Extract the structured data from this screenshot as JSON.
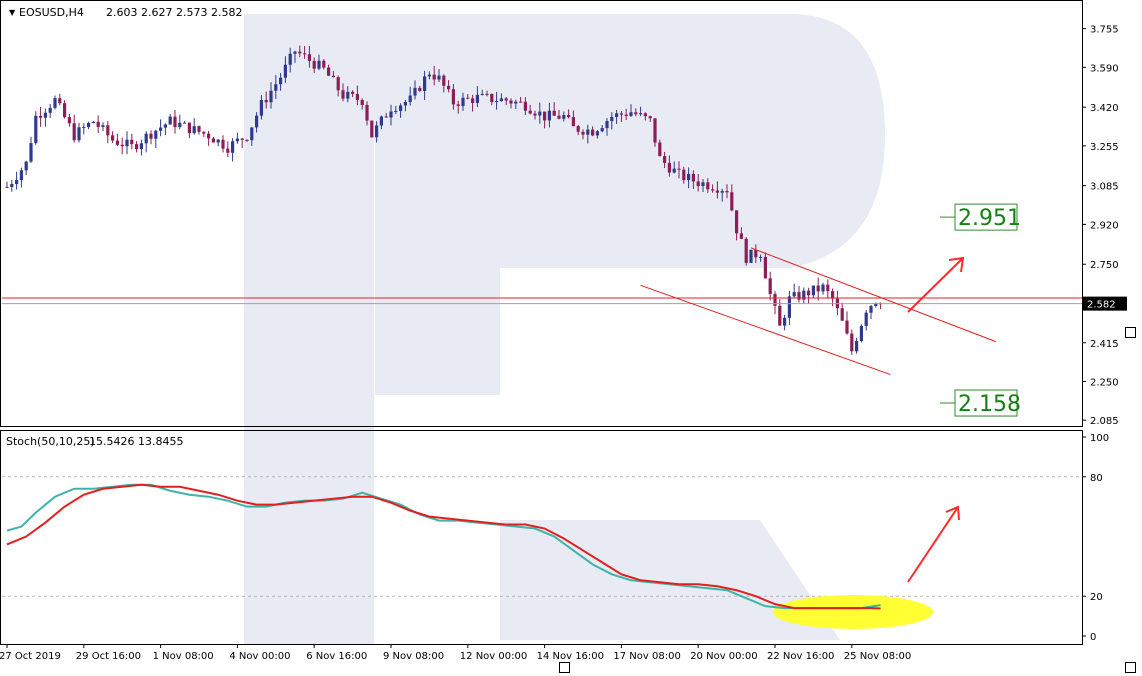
{
  "chart_header": {
    "symbol_label": "EOSUSD,H4",
    "ohlc_text": "2.603 2.627 2.573 2.582"
  },
  "indicator_header": {
    "label": "Stoch(50,10,25)",
    "values_text": "15.5426 13.8455"
  },
  "colors": {
    "bull_candle": "#2f3a8c",
    "bear_candle": "#8b1e56",
    "price_line": "#e02020",
    "stoch_main": "#3fb3a8",
    "stoch_signal": "#e02020",
    "annotation_arrow": "#ff2a2a",
    "target_box_border": "#2e8b2e",
    "target_text": "#168016",
    "highlight_ellipse": "#ffff33",
    "watermark": "#e8ebf4"
  },
  "chart_data": [
    {
      "type": "candlestick",
      "title": "EOSUSD,H4",
      "price_axis_ticks": [
        "3.755",
        "3.590",
        "3.420",
        "3.255",
        "3.085",
        "2.920",
        "2.750",
        "2.580",
        "2.415",
        "2.250",
        "2.085"
      ],
      "price_axis_tick_values": [
        3.755,
        3.59,
        3.42,
        3.255,
        3.085,
        2.92,
        2.75,
        2.58,
        2.415,
        2.25,
        2.085
      ],
      "ylim": [
        2.06,
        3.86
      ],
      "current_price_label": "2.582",
      "current_price": 2.582,
      "red_level": 2.606,
      "x_axis_labels": [
        "27 Oct 2019",
        "29 Oct 16:00",
        "1 Nov 08:00",
        "4 Nov 00:00",
        "6 Nov 16:00",
        "9 Nov 08:00",
        "12 Nov 00:00",
        "14 Nov 16:00",
        "17 Nov 08:00",
        "20 Nov 00:00",
        "22 Nov 16:00",
        "25 Nov 08:00"
      ],
      "x_axis_label_bar_index": [
        0,
        16,
        32,
        48,
        64,
        80,
        96,
        112,
        128,
        144,
        160,
        176
      ],
      "candle_count": 183,
      "close_path": [
        [
          0,
          3.08
        ],
        [
          4,
          3.18
        ],
        [
          6,
          3.38
        ],
        [
          10,
          3.45
        ],
        [
          14,
          3.3
        ],
        [
          18,
          3.36
        ],
        [
          22,
          3.28
        ],
        [
          26,
          3.25
        ],
        [
          30,
          3.31
        ],
        [
          34,
          3.36
        ],
        [
          38,
          3.33
        ],
        [
          42,
          3.3
        ],
        [
          46,
          3.25
        ],
        [
          50,
          3.3
        ],
        [
          53,
          3.43
        ],
        [
          57,
          3.55
        ],
        [
          60,
          3.66
        ],
        [
          63,
          3.62
        ],
        [
          66,
          3.58
        ],
        [
          70,
          3.47
        ],
        [
          74,
          3.45
        ],
        [
          76,
          3.3
        ],
        [
          80,
          3.42
        ],
        [
          84,
          3.45
        ],
        [
          88,
          3.57
        ],
        [
          90,
          3.54
        ],
        [
          93,
          3.44
        ],
        [
          98,
          3.46
        ],
        [
          104,
          3.45
        ],
        [
          108,
          3.43
        ],
        [
          112,
          3.38
        ],
        [
          116,
          3.38
        ],
        [
          118,
          3.33
        ],
        [
          122,
          3.32
        ],
        [
          126,
          3.38
        ],
        [
          130,
          3.4
        ],
        [
          134,
          3.36
        ],
        [
          136,
          3.2
        ],
        [
          140,
          3.13
        ],
        [
          144,
          3.1
        ],
        [
          150,
          3.07
        ],
        [
          152,
          2.9
        ],
        [
          154,
          2.78
        ],
        [
          157,
          2.8
        ],
        [
          159,
          2.62
        ],
        [
          161,
          2.48
        ],
        [
          163,
          2.6
        ],
        [
          167,
          2.63
        ],
        [
          170,
          2.65
        ],
        [
          172,
          2.6
        ],
        [
          174,
          2.5
        ],
        [
          176,
          2.38
        ],
        [
          177,
          2.44
        ],
        [
          179,
          2.56
        ],
        [
          181,
          2.6
        ],
        [
          182,
          2.582
        ]
      ],
      "channel_upper": [
        [
          155,
          2.82
        ],
        [
          206,
          2.42
        ]
      ],
      "channel_lower": [
        [
          132,
          2.66
        ],
        [
          184,
          2.28
        ]
      ],
      "target_up_label": "2.951",
      "target_up_value": 2.951,
      "target_down_label": "2.158",
      "target_down_value": 2.158
    },
    {
      "type": "line",
      "title": "Stoch(50,10,25)",
      "y_axis_ticks": [
        "100",
        "80",
        "20",
        "0"
      ],
      "y_axis_tick_values": [
        100,
        80,
        20,
        0
      ],
      "levels": [
        80,
        20
      ],
      "ylim": [
        0,
        100
      ],
      "series": [
        {
          "name": "main",
          "value_label": "15.5426",
          "points": [
            [
              0,
              53
            ],
            [
              3,
              55
            ],
            [
              6,
              62
            ],
            [
              10,
              70
            ],
            [
              14,
              74
            ],
            [
              18,
              74
            ],
            [
              22,
              75
            ],
            [
              26,
              76
            ],
            [
              30,
              76
            ],
            [
              34,
              73
            ],
            [
              38,
              71
            ],
            [
              42,
              70
            ],
            [
              46,
              68
            ],
            [
              50,
              65
            ],
            [
              54,
              65
            ],
            [
              58,
              67
            ],
            [
              62,
              68
            ],
            [
              66,
              68
            ],
            [
              70,
              69
            ],
            [
              74,
              72
            ],
            [
              78,
              69
            ],
            [
              82,
              66
            ],
            [
              86,
              61
            ],
            [
              90,
              58
            ],
            [
              94,
              58
            ],
            [
              98,
              57
            ],
            [
              102,
              56
            ],
            [
              106,
              55
            ],
            [
              110,
              54
            ],
            [
              114,
              50
            ],
            [
              118,
              43
            ],
            [
              122,
              36
            ],
            [
              126,
              31
            ],
            [
              130,
              28
            ],
            [
              134,
              27
            ],
            [
              138,
              26
            ],
            [
              142,
              25
            ],
            [
              146,
              24
            ],
            [
              150,
              23
            ],
            [
              154,
              19
            ],
            [
              158,
              15
            ],
            [
              162,
              14
            ],
            [
              166,
              14
            ],
            [
              170,
              14
            ],
            [
              174,
              14
            ],
            [
              178,
              14
            ],
            [
              182,
              15.5
            ]
          ]
        },
        {
          "name": "signal",
          "value_label": "13.8455",
          "points": [
            [
              0,
              46
            ],
            [
              4,
              50
            ],
            [
              8,
              57
            ],
            [
              12,
              65
            ],
            [
              16,
              71
            ],
            [
              20,
              74
            ],
            [
              24,
              75
            ],
            [
              28,
              76
            ],
            [
              32,
              75
            ],
            [
              36,
              75
            ],
            [
              40,
              73
            ],
            [
              44,
              71
            ],
            [
              48,
              68
            ],
            [
              52,
              66
            ],
            [
              56,
              66
            ],
            [
              60,
              67
            ],
            [
              64,
              68
            ],
            [
              68,
              69
            ],
            [
              72,
              70
            ],
            [
              76,
              70
            ],
            [
              80,
              67
            ],
            [
              84,
              63
            ],
            [
              88,
              60
            ],
            [
              92,
              59
            ],
            [
              96,
              58
            ],
            [
              100,
              57
            ],
            [
              104,
              56
            ],
            [
              108,
              56
            ],
            [
              112,
              54
            ],
            [
              116,
              49
            ],
            [
              120,
              43
            ],
            [
              124,
              37
            ],
            [
              128,
              31
            ],
            [
              132,
              28
            ],
            [
              136,
              27
            ],
            [
              140,
              26
            ],
            [
              144,
              26
            ],
            [
              148,
              25
            ],
            [
              152,
              23
            ],
            [
              156,
              20
            ],
            [
              160,
              16
            ],
            [
              164,
              14
            ],
            [
              168,
              14
            ],
            [
              172,
              14
            ],
            [
              176,
              14
            ],
            [
              180,
              14
            ],
            [
              182,
              13.8
            ]
          ]
        }
      ]
    }
  ]
}
